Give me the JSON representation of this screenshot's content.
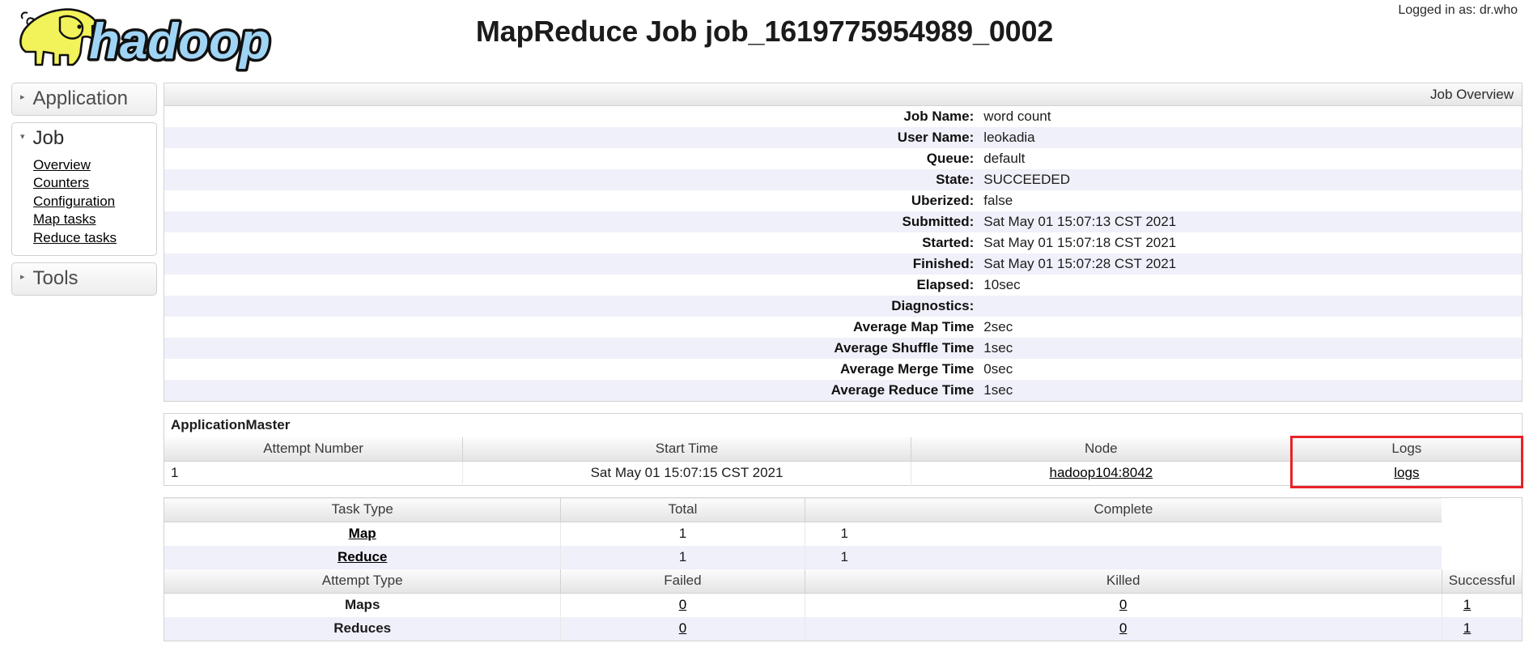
{
  "header": {
    "title": "MapReduce Job job_1619775954989_0002",
    "logged_in": "Logged in as: dr.who",
    "logo_alt": "hadoop"
  },
  "sidebar": {
    "groups": [
      {
        "label": "Application",
        "icon": "chevron-right-icon",
        "expanded": false,
        "links": []
      },
      {
        "label": "Job",
        "icon": "chevron-down-icon",
        "expanded": true,
        "links": [
          "Overview",
          "Counters",
          "Configuration",
          "Map tasks",
          "Reduce tasks"
        ]
      },
      {
        "label": "Tools",
        "icon": "chevron-right-icon",
        "expanded": false,
        "links": []
      }
    ]
  },
  "job_overview": {
    "caption": "Job Overview",
    "rows": [
      {
        "key": "Job Name:",
        "value": "word count"
      },
      {
        "key": "User Name:",
        "value": "leokadia"
      },
      {
        "key": "Queue:",
        "value": "default"
      },
      {
        "key": "State:",
        "value": "SUCCEEDED"
      },
      {
        "key": "Uberized:",
        "value": "false"
      },
      {
        "key": "Submitted:",
        "value": "Sat May 01 15:07:13 CST 2021"
      },
      {
        "key": "Started:",
        "value": "Sat May 01 15:07:18 CST 2021"
      },
      {
        "key": "Finished:",
        "value": "Sat May 01 15:07:28 CST 2021"
      },
      {
        "key": "Elapsed:",
        "value": "10sec"
      },
      {
        "key": "Diagnostics:",
        "value": ""
      },
      {
        "key": "Average Map Time",
        "value": "2sec"
      },
      {
        "key": "Average Shuffle Time",
        "value": "1sec"
      },
      {
        "key": "Average Merge Time",
        "value": "0sec"
      },
      {
        "key": "Average Reduce Time",
        "value": "1sec"
      }
    ]
  },
  "application_master": {
    "title": "ApplicationMaster",
    "columns": [
      "Attempt Number",
      "Start Time",
      "Node",
      "Logs"
    ],
    "rows": [
      {
        "attempt_number": "1",
        "start_time": "Sat May 01 15:07:15 CST 2021",
        "node": "hadoop104:8042",
        "logs": "logs"
      }
    ],
    "highlight_color": "#e8222a"
  },
  "task_summary": {
    "columns": [
      "Task Type",
      "Total",
      "Complete"
    ],
    "rows": [
      {
        "task_type": "Map",
        "total": "1",
        "complete": "1"
      },
      {
        "task_type": "Reduce",
        "total": "1",
        "complete": "1"
      }
    ]
  },
  "attempt_summary": {
    "columns": [
      "Attempt Type",
      "Failed",
      "Killed",
      "Successful"
    ],
    "rows": [
      {
        "attempt_type": "Maps",
        "failed": "0",
        "killed": "0",
        "successful": "1"
      },
      {
        "attempt_type": "Reduces",
        "failed": "0",
        "killed": "0",
        "successful": "1"
      }
    ]
  }
}
